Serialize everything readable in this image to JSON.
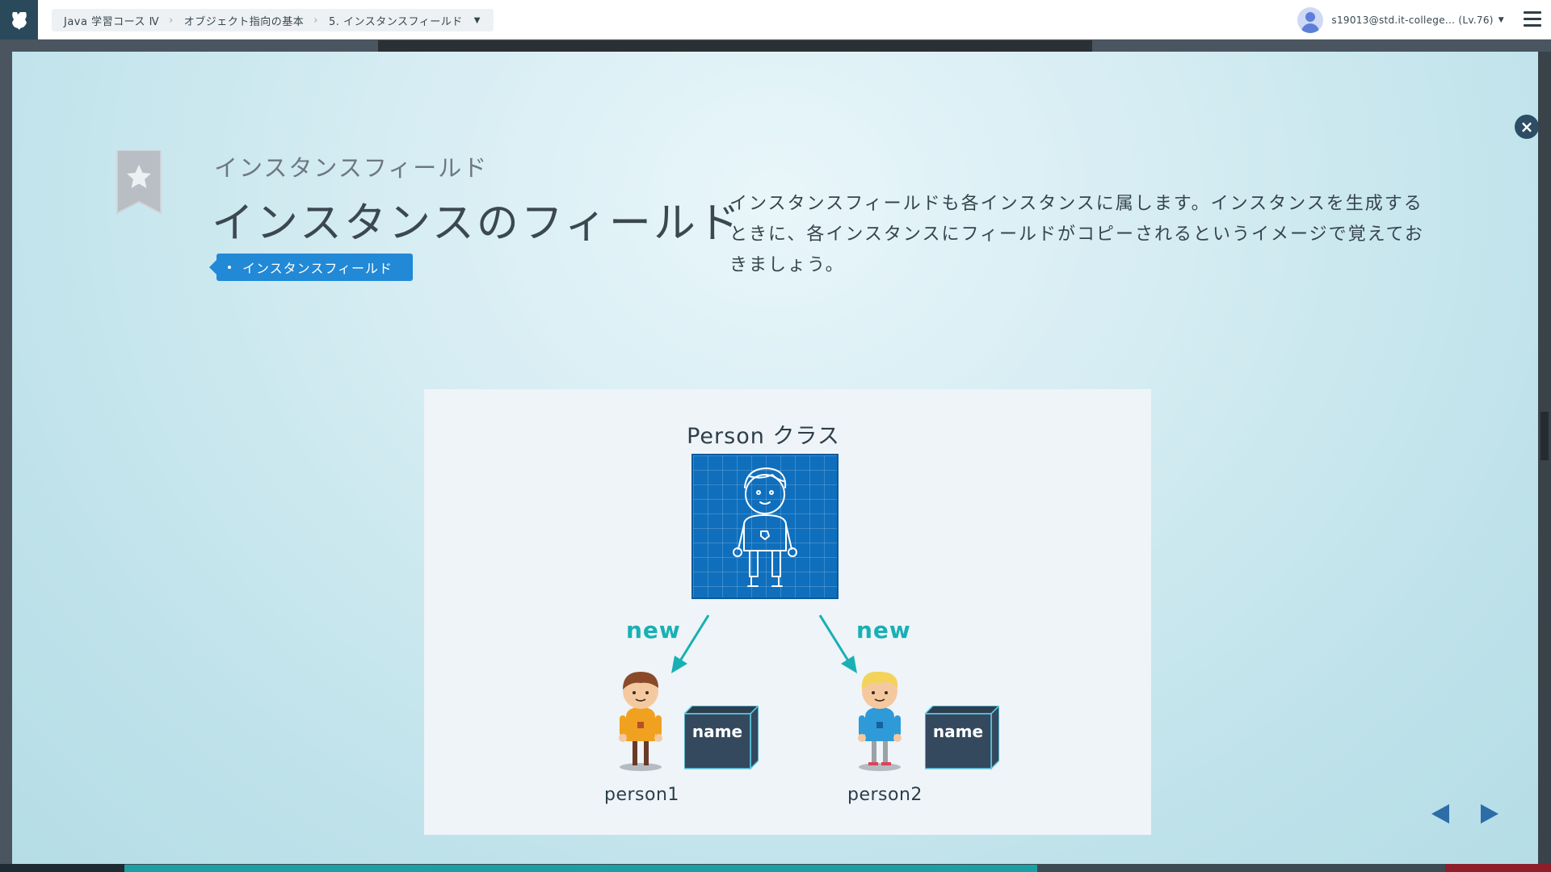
{
  "header": {
    "breadcrumb": {
      "course": "Java 学習コース Ⅳ",
      "chapter": "オブジェクト指向の基本",
      "lesson": "5. インスタンスフィールド"
    },
    "user": {
      "name": "s19013@std.it-college... (Lv.76)"
    }
  },
  "slide": {
    "subtitle": "インスタンスフィールド",
    "title": "インスタンスのフィールド",
    "tag": "インスタンスフィールド",
    "description": "インスタンスフィールドも各インスタンスに属します。インスタンスを生成するときに、各インスタンスにフィールドがコピーされるというイメージで覚えておきましょう。"
  },
  "figure": {
    "class_title": "Person クラス",
    "left_new": "new",
    "right_new": "new",
    "instance1_label": "person1",
    "instance2_label": "person2",
    "field1_label": "name",
    "field2_label": "name"
  },
  "progress": {
    "fraction": 0.64
  },
  "colors": {
    "accent_blue": "#2189d6",
    "teal": "#18b0b4",
    "navy": "#2c4e64"
  }
}
